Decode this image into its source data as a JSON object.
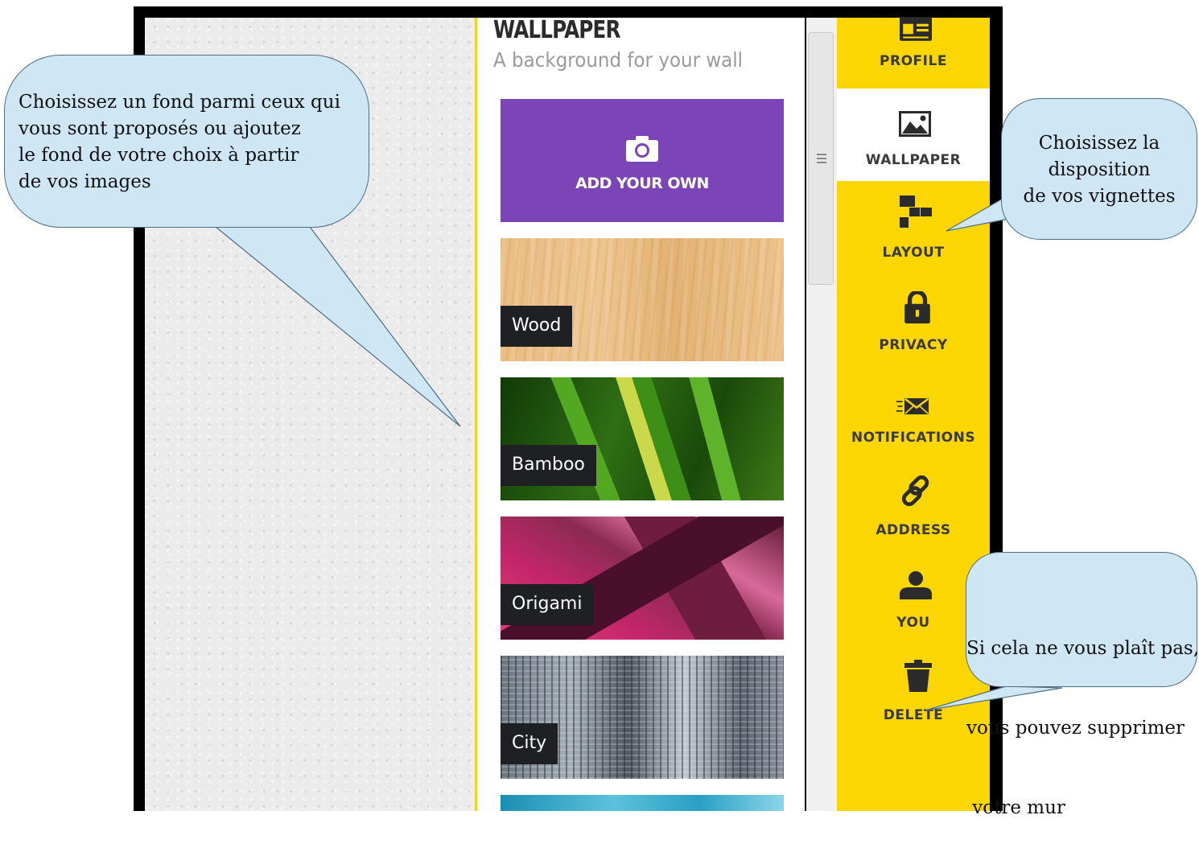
{
  "panel": {
    "title": "WALLPAPER",
    "subtitle": "A background for your wall",
    "add_own_label": "ADD YOUR OWN"
  },
  "wallpapers": [
    {
      "label": "Wood"
    },
    {
      "label": "Bamboo"
    },
    {
      "label": "Origami"
    },
    {
      "label": "City"
    }
  ],
  "sidebar": {
    "items": [
      {
        "label": "PROFILE",
        "icon": "profile-icon"
      },
      {
        "label": "WALLPAPER",
        "icon": "image-icon",
        "active": true
      },
      {
        "label": "LAYOUT",
        "icon": "layout-icon"
      },
      {
        "label": "PRIVACY",
        "icon": "lock-icon"
      },
      {
        "label": "NOTIFICATIONS",
        "icon": "envelope-icon"
      },
      {
        "label": "ADDRESS",
        "icon": "link-icon"
      },
      {
        "label": "YOU",
        "icon": "user-icon"
      },
      {
        "label": "DELETE",
        "icon": "trash-icon"
      }
    ]
  },
  "callouts": {
    "left": [
      "Choisissez un fond parmi ceux qui",
      "vous sont proposés ou ajoutez",
      "le fond de votre choix à partir",
      "de vos images"
    ],
    "layout": [
      "Choisissez la",
      "disposition",
      "de vos vignettes"
    ],
    "delete": [
      "Si cela ne vous plaît pas,",
      "vous pouvez supprimer",
      " votre mur"
    ]
  },
  "colors": {
    "sidebar": "#fcd600",
    "add_own": "#7b45b8",
    "callout": "#cfe6f5"
  }
}
